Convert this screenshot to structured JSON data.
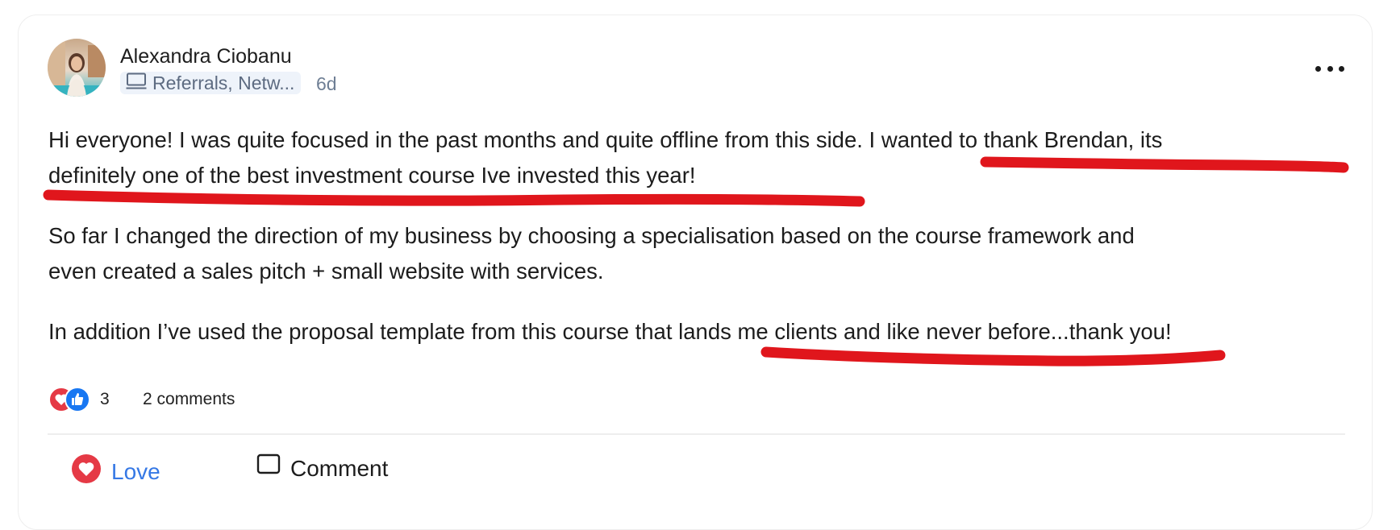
{
  "post": {
    "author": "Alexandra Ciobanu",
    "group": "Referrals, Netw...",
    "time": "6d",
    "paragraphs": [
      [
        "Hi everyone! I was quite focused in the past months and quite offline from this side. I wanted to thank Brendan, its",
        "definitely one of the best investment course Ive invested this year!"
      ],
      [
        "So far I changed the direction of my business by choosing a specialisation based on the course framework and",
        "even created a sales pitch + small website with services."
      ],
      [
        "In addition I’ve used the proposal template from this course that lands me clients and like never before...thank you!"
      ]
    ]
  },
  "stats": {
    "reaction_count": "3",
    "comments": "2 comments"
  },
  "actions": {
    "love": "Love",
    "comment": "Comment"
  },
  "icons": {
    "group": "computer-icon",
    "more": "more-options-icon",
    "love_reaction": "heart-icon",
    "like_reaction": "thumbs-up-icon",
    "comment": "comment-icon"
  },
  "colors": {
    "highlight": "#e0161c",
    "love": "#e53945",
    "like": "#1877f2",
    "link": "#3578e5"
  }
}
